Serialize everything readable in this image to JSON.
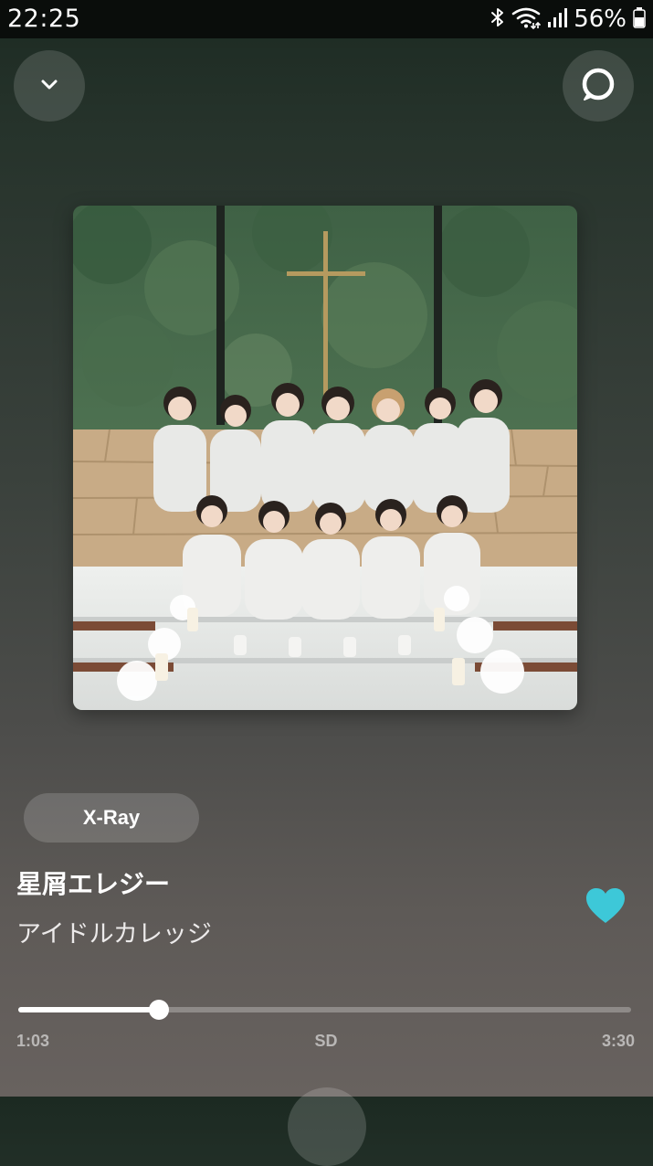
{
  "status_bar": {
    "time": "22:25",
    "battery": "56%",
    "icons": [
      "bluetooth-icon",
      "wifi-icon",
      "signal-icon",
      "battery-icon"
    ]
  },
  "header": {
    "collapse_icon": "chevron-down-icon",
    "alexa_icon": "alexa-ring-icon"
  },
  "album_art": {
    "description_icon": "album-cover-image"
  },
  "xray": {
    "label": "X-Ray"
  },
  "track": {
    "title": "星屑エレジー",
    "artist": "アイドルカレッジ",
    "liked": true,
    "like_color": "#3dc8d8"
  },
  "playback": {
    "elapsed": "1:03",
    "quality": "SD",
    "total": "3:30",
    "progress": 0.23
  },
  "colors": {
    "background_top": "#1c2a22",
    "background_bottom": "#68625f",
    "accent": "#3dc8d8"
  }
}
